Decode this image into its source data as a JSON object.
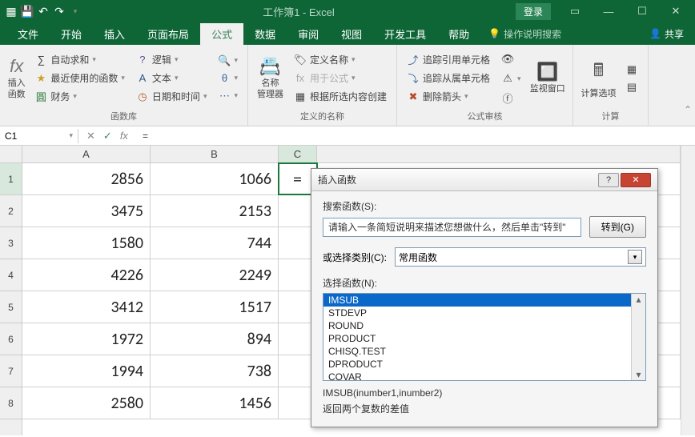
{
  "titlebar": {
    "title": "工作簿1 - Excel",
    "login": "登录"
  },
  "menu": {
    "items": [
      "文件",
      "开始",
      "插入",
      "页面布局",
      "公式",
      "数据",
      "审阅",
      "视图",
      "开发工具",
      "帮助"
    ],
    "tellme": "操作说明搜索",
    "share": "共享"
  },
  "ribbon": {
    "g1": {
      "big": "插入函数",
      "c1": "自动求和",
      "c2": "最近使用的函数",
      "c3": "财务",
      "c4": "逻辑",
      "c5": "文本",
      "c6": "日期和时间",
      "label": "函数库"
    },
    "g2": {
      "big": "名称\n管理器",
      "c1": "定义名称",
      "c2": "用于公式",
      "c3": "根据所选内容创建",
      "label": "定义的名称"
    },
    "g3": {
      "c1": "追踪引用单元格",
      "c2": "追踪从属单元格",
      "c3": "删除箭头",
      "big": "监视窗口",
      "label": "公式审核"
    },
    "g4": {
      "big": "计算选项",
      "label": "计算"
    }
  },
  "formula": {
    "namebox": "C1",
    "value": "="
  },
  "cols": [
    "A",
    "B",
    "C"
  ],
  "rows": [
    "1",
    "2",
    "3",
    "4",
    "5",
    "6",
    "7",
    "8"
  ],
  "data": {
    "A": [
      "2856",
      "3475",
      "1580",
      "4226",
      "3412",
      "1972",
      "1994",
      "2580"
    ],
    "B": [
      "1066",
      "2153",
      "744",
      "2249",
      "1517",
      "894",
      "738",
      "1456"
    ],
    "C": [
      "=",
      "",
      "",
      "",
      "",
      "",
      "",
      ""
    ]
  },
  "dialog": {
    "title": "插入函数",
    "search_label": "搜索函数(S):",
    "search_text": "请输入一条简短说明来描述您想做什么，然后单击\"转到\"",
    "go": "转到(G)",
    "cat_label": "或选择类别(C):",
    "cat_value": "常用函数",
    "sel_label": "选择函数(N):",
    "funcs": [
      "IMSUB",
      "STDEVP",
      "ROUND",
      "PRODUCT",
      "CHISQ.TEST",
      "DPRODUCT",
      "COVAR"
    ],
    "sig": "IMSUB(inumber1,inumber2)",
    "desc": "返回两个复数的差值"
  }
}
